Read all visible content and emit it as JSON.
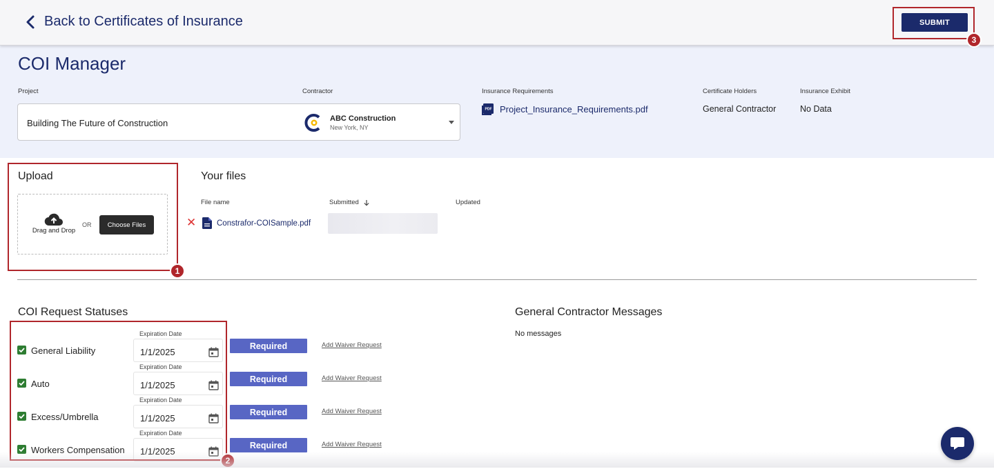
{
  "header": {
    "back_label": "Back to Certificates of Insurance",
    "submit_label": "SUBMIT"
  },
  "page": {
    "title": "COI Manager"
  },
  "project": {
    "label": "Project",
    "value": "Building The Future of Construction"
  },
  "contractor": {
    "label": "Contractor",
    "name": "ABC Construction",
    "location": "New York, NY"
  },
  "insurance_requirements": {
    "label": "Insurance Requirements",
    "file": "Project_Insurance_Requirements.pdf",
    "icon": "pdf-icon"
  },
  "certificate_holders": {
    "label": "Certificate Holders",
    "value": "General Contractor"
  },
  "insurance_exhibit": {
    "label": "Insurance Exhibit",
    "value": "No Data"
  },
  "upload": {
    "title": "Upload",
    "drag_label": "Drag and Drop",
    "or_label": "OR",
    "choose_label": "Choose Files"
  },
  "files": {
    "title": "Your files",
    "columns": [
      "File name",
      "Submitted",
      "Updated"
    ],
    "rows": [
      {
        "name": "Constrafor-COISample.pdf"
      }
    ]
  },
  "statuses": {
    "title": "COI Request Statuses",
    "expiration_label": "Expiration Date",
    "required_label": "Required",
    "waiver_label": "Add Waiver Request",
    "items": [
      {
        "label": "General Liability",
        "date": "1/1/2025",
        "checked": true
      },
      {
        "label": "Auto",
        "date": "1/1/2025",
        "checked": true
      },
      {
        "label": "Excess/Umbrella",
        "date": "1/1/2025",
        "checked": true
      },
      {
        "label": "Workers Compensation",
        "date": "1/1/2025",
        "checked": true
      }
    ]
  },
  "messages": {
    "title": "General Contractor Messages",
    "empty": "No messages"
  },
  "annotations": [
    "1",
    "2",
    "3"
  ],
  "colors": {
    "brand": "#1b2a6b",
    "required": "#5866c4",
    "check": "#2e7d32",
    "annotation": "#b0262b",
    "top_bg": "#eef1fb"
  }
}
